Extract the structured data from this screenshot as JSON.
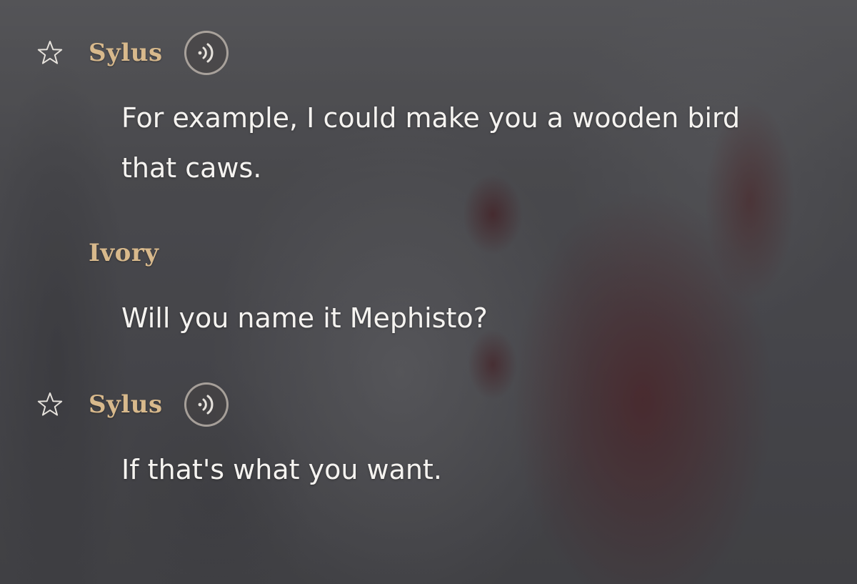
{
  "messages": [
    {
      "speaker": "Sylus",
      "favoritable": true,
      "has_voice": true,
      "text": "For example, I could make you a wooden bird that caws."
    },
    {
      "speaker": "Ivory",
      "favoritable": false,
      "has_voice": false,
      "text": "Will you name it Mephisto?"
    },
    {
      "speaker": "Sylus",
      "favoritable": true,
      "has_voice": true,
      "text": "If that's what you want."
    }
  ],
  "icons": {
    "favorite": "star-outline-icon",
    "voice": "sound-wave-icon"
  },
  "colors": {
    "speaker_name": "#d8b98c",
    "dialogue_text": "#f5f3f0",
    "icon_stroke": "#e6e2dc"
  }
}
